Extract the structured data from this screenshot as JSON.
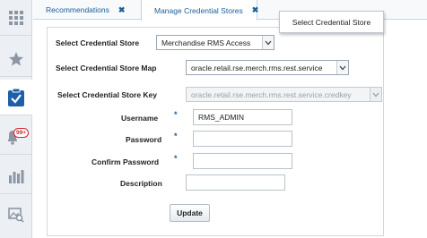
{
  "nav": {
    "badge": "99+"
  },
  "tabs": [
    {
      "label": "Recommendations",
      "close": "✖"
    },
    {
      "label": "Manage Credential Stores",
      "close": "✖"
    }
  ],
  "tooltip": "Select Credential Store",
  "form": {
    "store_label": "Select Credential Store",
    "store_value": "Merchandise RMS Access",
    "map_label": "Select Credential Store Map",
    "map_value": "oracle.retail.rse.merch.rms.rest.service",
    "key_label": "Select Credential Store Key",
    "key_value": "oracle.retail.rse.merch.rms.rest.service.credkey",
    "username_label": "Username",
    "username_value": "RMS_ADMIN",
    "password_label": "Password",
    "confirm_label": "Confirm Password",
    "description_label": "Description",
    "required_mark": "*",
    "update_label": "Update"
  }
}
